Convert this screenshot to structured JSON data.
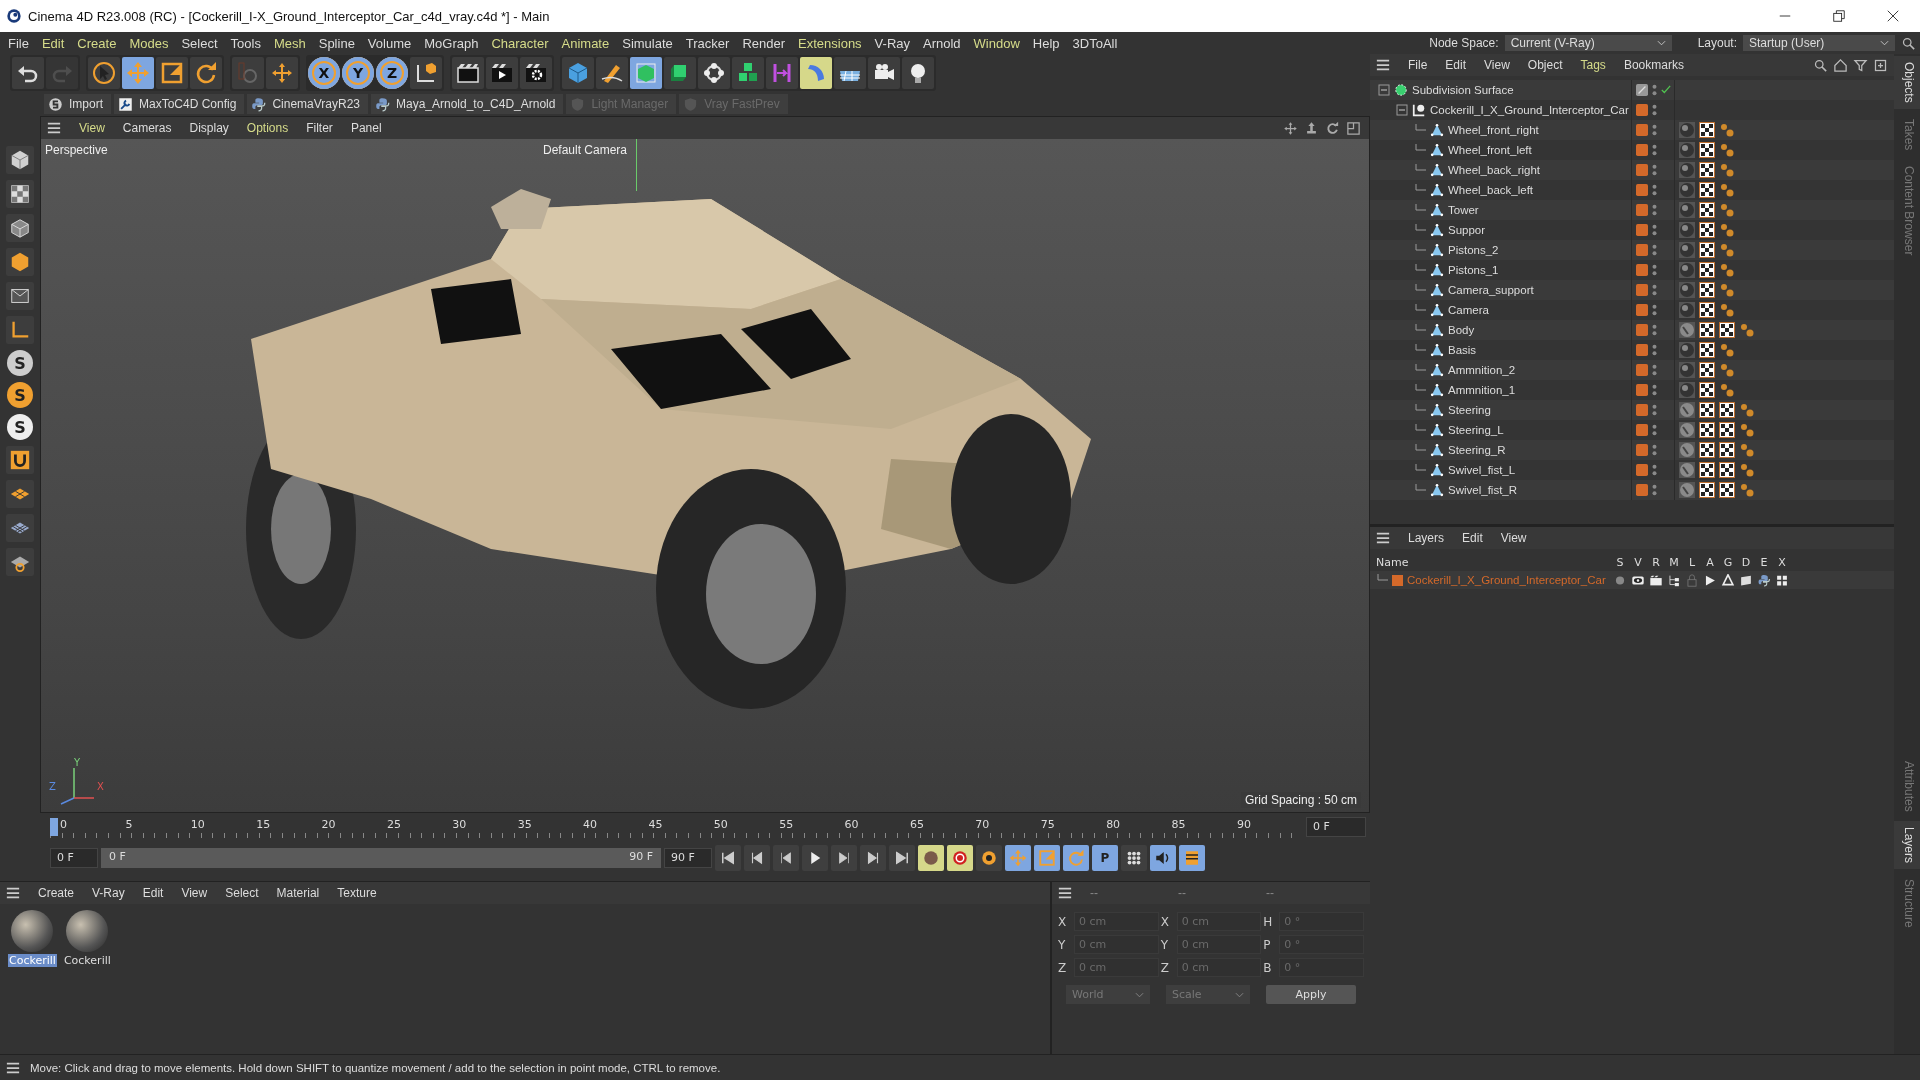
{
  "window": {
    "title": "Cinema 4D R23.008 (RC) - [Cockerill_I-X_Ground_Interceptor_Car_c4d_vray.c4d *] - Main"
  },
  "menu": [
    {
      "label": "File",
      "highlight": false
    },
    {
      "label": "Edit",
      "highlight": true
    },
    {
      "label": "Create",
      "highlight": true
    },
    {
      "label": "Modes",
      "highlight": true
    },
    {
      "label": "Select",
      "highlight": false
    },
    {
      "label": "Tools",
      "highlight": false
    },
    {
      "label": "Mesh",
      "highlight": true
    },
    {
      "label": "Spline",
      "highlight": false
    },
    {
      "label": "Volume",
      "highlight": false
    },
    {
      "label": "MoGraph",
      "highlight": false
    },
    {
      "label": "Character",
      "highlight": true
    },
    {
      "label": "Animate",
      "highlight": true
    },
    {
      "label": "Simulate",
      "highlight": false
    },
    {
      "label": "Tracker",
      "highlight": false
    },
    {
      "label": "Render",
      "highlight": false
    },
    {
      "label": "Extensions",
      "highlight": true
    },
    {
      "label": "V-Ray",
      "highlight": false
    },
    {
      "label": "Arnold",
      "highlight": false
    },
    {
      "label": "Window",
      "highlight": true
    },
    {
      "label": "Help",
      "highlight": false
    },
    {
      "label": "3DToAll",
      "highlight": false
    }
  ],
  "node_space": {
    "label": "Node Space:",
    "value": "Current (V-Ray)"
  },
  "layout": {
    "label": "Layout:",
    "value": "Startup (User)"
  },
  "toolbar": {
    "tools": [
      {
        "kind": "select",
        "selected": false
      },
      {
        "kind": "move",
        "selected": true
      },
      {
        "kind": "scale",
        "selected": false
      },
      {
        "kind": "rotate",
        "selected": false
      }
    ],
    "axis_locks": [
      {
        "label": "X",
        "on": true
      },
      {
        "label": "Y",
        "on": true
      },
      {
        "label": "Z",
        "on": true
      }
    ]
  },
  "plugins": [
    {
      "label": "Import",
      "disabled": false
    },
    {
      "label": "MaxToC4D Config",
      "disabled": false
    },
    {
      "label": "CinemaVrayR23",
      "disabled": false
    },
    {
      "label": "Maya_Arnold_to_C4D_Arnold",
      "disabled": false
    },
    {
      "label": "Light Manager",
      "disabled": true
    },
    {
      "label": "Vray FastPrev",
      "disabled": true
    }
  ],
  "left_tools": {
    "letter_icons": [
      "S",
      "S",
      "S"
    ]
  },
  "viewport": {
    "menu": [
      {
        "label": "View",
        "highlight": true
      },
      {
        "label": "Cameras",
        "highlight": false
      },
      {
        "label": "Display",
        "highlight": false
      },
      {
        "label": "Options",
        "highlight": true
      },
      {
        "label": "Filter",
        "highlight": false
      },
      {
        "label": "Panel",
        "highlight": false
      }
    ],
    "projection": "Perspective",
    "camera": "Default Camera",
    "grid_spacing": "Grid Spacing : 50 cm",
    "axes": [
      "Y",
      "Z",
      "X"
    ]
  },
  "objects": {
    "menu": [
      {
        "label": "File",
        "highlight": false
      },
      {
        "label": "Edit",
        "highlight": false
      },
      {
        "label": "View",
        "highlight": false
      },
      {
        "label": "Object",
        "highlight": false
      },
      {
        "label": "Tags",
        "highlight": true
      },
      {
        "label": "Bookmarks",
        "highlight": false
      }
    ],
    "tree": [
      {
        "name": "Subdivision Surface",
        "kind": "subdivision",
        "expanded": true,
        "children": [
          {
            "name": "Cockerill_I_X_Ground_Interceptor_Car",
            "kind": "null",
            "expanded": true,
            "children": [
              {
                "name": "Wheel_front_right",
                "kind": "polygon",
                "tags": [
                  {
                    "kind": "material"
                  },
                  {
                    "kind": "texture"
                  },
                  {
                    "kind": "vray"
                  }
                ]
              },
              {
                "name": "Wheel_front_left",
                "kind": "polygon",
                "tags": [
                  {
                    "kind": "material"
                  },
                  {
                    "kind": "texture"
                  },
                  {
                    "kind": "vray"
                  }
                ]
              },
              {
                "name": "Wheel_back_right",
                "kind": "polygon",
                "tags": [
                  {
                    "kind": "material"
                  },
                  {
                    "kind": "texture"
                  },
                  {
                    "kind": "vray"
                  }
                ]
              },
              {
                "name": "Wheel_back_left",
                "kind": "polygon",
                "tags": [
                  {
                    "kind": "material"
                  },
                  {
                    "kind": "texture"
                  },
                  {
                    "kind": "vray"
                  }
                ]
              },
              {
                "name": "Tower",
                "kind": "polygon",
                "tags": [
                  {
                    "kind": "material"
                  },
                  {
                    "kind": "texture"
                  },
                  {
                    "kind": "vray"
                  }
                ]
              },
              {
                "name": "Suppor",
                "kind": "polygon",
                "tags": [
                  {
                    "kind": "material"
                  },
                  {
                    "kind": "texture"
                  },
                  {
                    "kind": "vray"
                  }
                ]
              },
              {
                "name": "Pistons_2",
                "kind": "polygon",
                "tags": [
                  {
                    "kind": "material"
                  },
                  {
                    "kind": "texture"
                  },
                  {
                    "kind": "vray"
                  }
                ]
              },
              {
                "name": "Pistons_1",
                "kind": "polygon",
                "tags": [
                  {
                    "kind": "material"
                  },
                  {
                    "kind": "texture"
                  },
                  {
                    "kind": "vray"
                  }
                ]
              },
              {
                "name": "Camera_support",
                "kind": "polygon",
                "tags": [
                  {
                    "kind": "material"
                  },
                  {
                    "kind": "texture"
                  },
                  {
                    "kind": "vray"
                  }
                ]
              },
              {
                "name": "Camera",
                "kind": "polygon",
                "tags": [
                  {
                    "kind": "material"
                  },
                  {
                    "kind": "texture"
                  },
                  {
                    "kind": "vray"
                  }
                ]
              },
              {
                "name": "Body",
                "kind": "polygon",
                "tags": [
                  {
                    "kind": "material2"
                  },
                  {
                    "kind": "texture"
                  },
                  {
                    "kind": "texture"
                  },
                  {
                    "kind": "vray"
                  }
                ]
              },
              {
                "name": "Basis",
                "kind": "polygon",
                "tags": [
                  {
                    "kind": "material"
                  },
                  {
                    "kind": "texture"
                  },
                  {
                    "kind": "vray"
                  }
                ]
              },
              {
                "name": "Ammnition_2",
                "kind": "polygon",
                "tags": [
                  {
                    "kind": "material"
                  },
                  {
                    "kind": "texture"
                  },
                  {
                    "kind": "vray"
                  }
                ]
              },
              {
                "name": "Ammnition_1",
                "kind": "polygon",
                "tags": [
                  {
                    "kind": "material"
                  },
                  {
                    "kind": "texture"
                  },
                  {
                    "kind": "vray"
                  }
                ]
              },
              {
                "name": "Steering",
                "kind": "polygon",
                "tags": [
                  {
                    "kind": "material2"
                  },
                  {
                    "kind": "texture"
                  },
                  {
                    "kind": "texture"
                  },
                  {
                    "kind": "vray"
                  }
                ]
              },
              {
                "name": "Steering_L",
                "kind": "polygon",
                "tags": [
                  {
                    "kind": "material2"
                  },
                  {
                    "kind": "texture"
                  },
                  {
                    "kind": "texture"
                  },
                  {
                    "kind": "vray"
                  }
                ]
              },
              {
                "name": "Steering_R",
                "kind": "polygon",
                "tags": [
                  {
                    "kind": "material2"
                  },
                  {
                    "kind": "texture"
                  },
                  {
                    "kind": "texture"
                  },
                  {
                    "kind": "vray"
                  }
                ]
              },
              {
                "name": "Swivel_fist_L",
                "kind": "polygon",
                "tags": [
                  {
                    "kind": "material2"
                  },
                  {
                    "kind": "texture"
                  },
                  {
                    "kind": "texture"
                  },
                  {
                    "kind": "vray"
                  }
                ]
              },
              {
                "name": "Swivel_fist_R",
                "kind": "polygon",
                "tags": [
                  {
                    "kind": "material2"
                  },
                  {
                    "kind": "texture"
                  },
                  {
                    "kind": "texture"
                  },
                  {
                    "kind": "vray"
                  }
                ]
              }
            ]
          }
        ]
      }
    ]
  },
  "layers": {
    "menu": [
      {
        "label": "Layers",
        "highlight": false
      },
      {
        "label": "Edit",
        "highlight": false
      },
      {
        "label": "View",
        "highlight": false
      }
    ],
    "columns": [
      "Name",
      "S",
      "V",
      "R",
      "M",
      "L",
      "A",
      "G",
      "D",
      "E",
      "X"
    ],
    "rows": [
      {
        "name": "Cockerill_I_X_Ground_Interceptor_Car",
        "color": "#d4692a"
      }
    ]
  },
  "side_tabs_top": [
    {
      "label": "Objects",
      "selected": true
    },
    {
      "label": "Takes",
      "selected": false
    },
    {
      "label": "Content Browser",
      "selected": false
    }
  ],
  "side_tabs_bottom": [
    {
      "label": "Attributes",
      "selected": false
    },
    {
      "label": "Layers",
      "selected": true
    },
    {
      "label": "Structure",
      "selected": false
    }
  ],
  "timeline": {
    "ticks": [
      "0",
      "5",
      "10",
      "15",
      "20",
      "25",
      "30",
      "35",
      "40",
      "45",
      "50",
      "55",
      "60",
      "65",
      "70",
      "75",
      "80",
      "85",
      "90"
    ],
    "level": 0,
    "current": "0 F",
    "start": "0 F",
    "range": {
      "start": "0 F",
      "end": "90 F",
      "level": 1
    },
    "end": "90 F",
    "key_letter": "P"
  },
  "materials": {
    "menu": [
      {
        "label": "Create",
        "highlight": false
      },
      {
        "label": "V-Ray",
        "highlight": false
      },
      {
        "label": "Edit",
        "highlight": false
      },
      {
        "label": "View",
        "highlight": false
      },
      {
        "label": "Select",
        "highlight": false
      },
      {
        "label": "Material",
        "highlight": false
      },
      {
        "label": "Texture",
        "highlight": false
      }
    ],
    "items": [
      {
        "name": "Cockerill",
        "selected": true
      },
      {
        "name": "Cockerill",
        "selected": false
      }
    ]
  },
  "coordinates": {
    "headers": [
      "--",
      "--",
      "--"
    ],
    "rows": [
      [
        {
          "axis": "X",
          "placeholder": "0 cm"
        },
        {
          "axis": "X",
          "placeholder": "0 cm"
        },
        {
          "axis": "H",
          "placeholder": "0 °"
        }
      ],
      [
        {
          "axis": "Y",
          "placeholder": "0 cm"
        },
        {
          "axis": "Y",
          "placeholder": "0 cm"
        },
        {
          "axis": "P",
          "placeholder": "0 °"
        }
      ],
      [
        {
          "axis": "Z",
          "placeholder": "0 cm"
        },
        {
          "axis": "Z",
          "placeholder": "0 cm"
        },
        {
          "axis": "B",
          "placeholder": "0 °"
        }
      ]
    ],
    "space": "World",
    "mode": "Scale",
    "apply": "Apply"
  },
  "status_bar": "Move: Click and drag to move elements. Hold down SHIFT to quantize movement / add to the selection in point mode, CTRL to remove."
}
